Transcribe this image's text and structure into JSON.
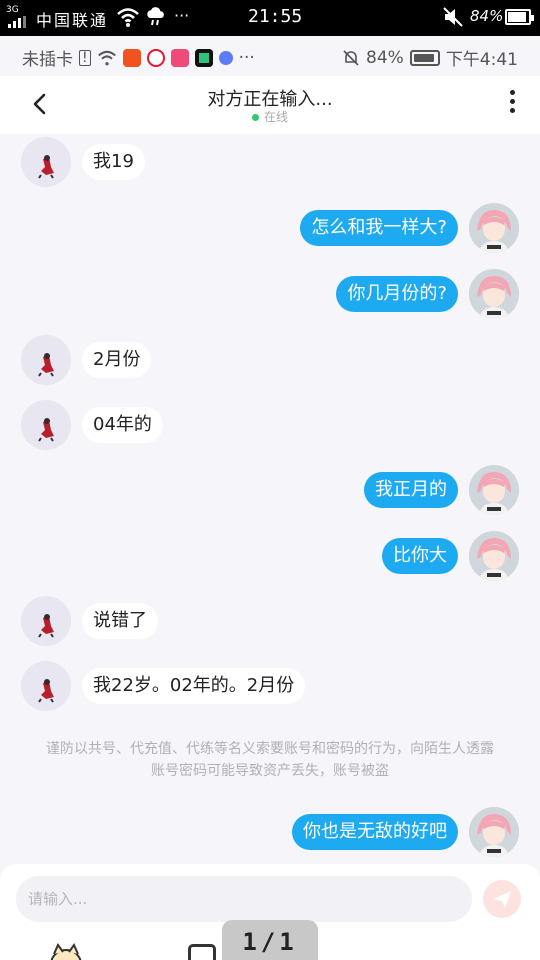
{
  "outer_status": {
    "network": "3G",
    "carrier": "中国联通",
    "dots": "···",
    "time": "21:55",
    "battery": "84%"
  },
  "inner_status": {
    "sim": "未插卡",
    "dots": "···",
    "battery": "84%",
    "time": "下午4:41"
  },
  "header": {
    "title": "对方正在输入...",
    "status": "在线"
  },
  "messages": [
    {
      "sender": "other",
      "text": "我19"
    },
    {
      "sender": "me",
      "text": "怎么和我一样大?"
    },
    {
      "sender": "me",
      "text": "你几月份的?"
    },
    {
      "sender": "other",
      "text": "2月份"
    },
    {
      "sender": "other",
      "text": "04年的"
    },
    {
      "sender": "me",
      "text": "我正月的"
    },
    {
      "sender": "me",
      "text": "比你大"
    },
    {
      "sender": "other",
      "text": "说错了"
    },
    {
      "sender": "other",
      "text": "我22岁。02年的。2月份"
    },
    {
      "sender": "me",
      "text": "你也是无敌的好吧"
    }
  ],
  "notice": "谨防以共号、代充值、代练等名义索要账号和密码的行为，向陌生人透露账号密码可能导致资产丢失，账号被盗",
  "input": {
    "placeholder": "请输入..."
  },
  "pager": "1/1",
  "colors": {
    "my_bubble": "#1eaaf1",
    "other_bubble": "#ffffff",
    "online_dot": "#2ecc71",
    "send_button": "#fde3e0"
  }
}
